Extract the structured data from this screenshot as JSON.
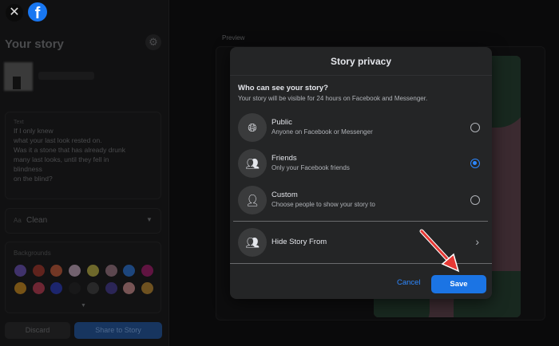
{
  "left": {
    "title": "Your story",
    "text_label": "Text",
    "poem": "If I only knew\nwhat your last look rested on.\nWas it a stone that has already drunk\nmany last looks, until they fell in\nblindness\non the blind?",
    "font_prefix": "Aa",
    "font_value": "Clean",
    "backgrounds_label": "Backgrounds",
    "background_colors": [
      "#7b5cd6",
      "#c0392b",
      "#e8673c",
      "#e8c6e0",
      "#e0d24a",
      "#b98a9a",
      "#2d88ff",
      "#c2187a",
      "#f3a31b",
      "#e0415a",
      "#2a3ddb",
      "#222222",
      "#444444",
      "#4b3fa8",
      "#f4a6a6",
      "#e0a030"
    ],
    "discard": "Discard",
    "share": "Share to Story"
  },
  "preview_label": "Preview",
  "modal": {
    "title": "Story privacy",
    "question": "Who can see your story?",
    "subtitle": "Your story will be visible for 24 hours on Facebook and Messenger.",
    "options": [
      {
        "title": "Public",
        "desc": "Anyone on Facebook or Messenger",
        "icon": "globe-icon",
        "selected": false
      },
      {
        "title": "Friends",
        "desc": "Only your Facebook friends",
        "icon": "friends-icon",
        "selected": true
      },
      {
        "title": "Custom",
        "desc": "Choose people to show your story to",
        "icon": "custom-person-icon",
        "selected": false
      }
    ],
    "hide_from": "Hide Story From",
    "cancel": "Cancel",
    "save": "Save"
  },
  "colors": {
    "accent": "#1b74e4",
    "modal_bg": "#242526",
    "arrow": "#e53935"
  }
}
